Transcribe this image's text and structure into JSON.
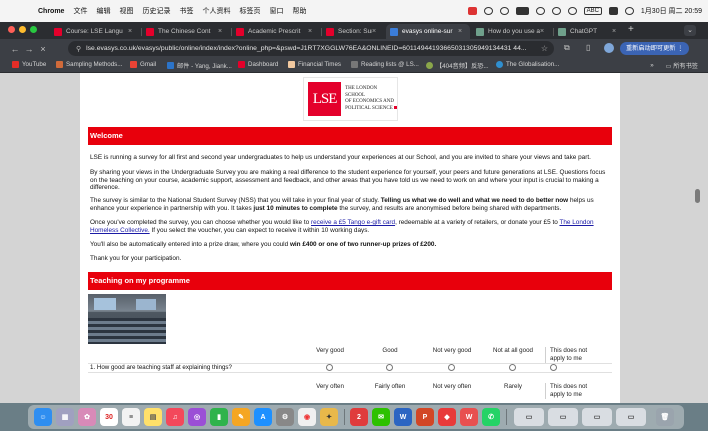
{
  "menubar": {
    "app": "Chrome",
    "items": [
      "文件",
      "编辑",
      "视图",
      "历史记录",
      "书签",
      "个人资料",
      "标签页",
      "窗口",
      "帮助"
    ],
    "input_method": "ABC",
    "datetime": "1月30日 周二  20:59"
  },
  "tabs": [
    {
      "label": "Course: LSE Langu",
      "color": "#e4002b"
    },
    {
      "label": "The Chinese Cont",
      "color": "#e4002b"
    },
    {
      "label": "Academic Prescrit",
      "color": "#e4002b"
    },
    {
      "label": "Section: Summatil",
      "color": "#e4002b"
    },
    {
      "label": "evasys online-sur",
      "color": "#3b7dd8",
      "active": true
    },
    {
      "label": "How do you use a",
      "color": "#6fa08b"
    },
    {
      "label": "ChatGPT",
      "color": "#6fa08b"
    }
  ],
  "toolbar": {
    "url": "lse.evasys.co.uk/evasys/public/online/index/index?online_php=&pswd=J1RT7XGGLW76EA&ONLINEID=60114944193665031305949134431 44...",
    "update_label": "重新启动即可更新"
  },
  "bookmarks": {
    "items": [
      {
        "label": "YouTube",
        "color": "#e52d27"
      },
      {
        "label": "Sampling Methods...",
        "color": "#d06a3a"
      },
      {
        "label": "Gmail",
        "color": "#ea4335"
      },
      {
        "label": "邮件 - Yang, Jiank...",
        "color": "#2b73c8"
      },
      {
        "label": "Dashboard",
        "color": "#e4002b"
      },
      {
        "label": "Financial Times",
        "color": "#f2c9a0"
      },
      {
        "label": "Reading lists @ LS...",
        "color": "#555555"
      },
      {
        "label": "【404音频】反恐...",
        "color": "#8aa64a"
      },
      {
        "label": "The Globalisation...",
        "color": "#2f8fd0"
      }
    ],
    "all_bookmarks": "所有书签"
  },
  "page": {
    "logo": {
      "mark": "LSE",
      "line1": "THE LONDON SCHOOL",
      "line2": "OF ECONOMICS AND",
      "line3": "POLITICAL SCIENCE"
    },
    "welcome": {
      "heading": "Welcome",
      "p1": "LSE is running a survey for all first and second year undergraduates to help us understand your experiences at our School, and you are invited to share your views and take part.",
      "p2a": "By sharing your views in the Undergraduate Survey you are making a real difference to the student experience for yourself, your peers and future generations at LSE. Questions focus on the teaching on your course, academic support, assessment and feedback, and other areas that you have told us we need to work on and where your input is crucial to making a difference.",
      "p3a": "The survey is similar to the National Student Survey (NSS) that you will take in your final year of study.",
      "p3b": "Telling us what we do well and what we need to do better now",
      "p3c": "helps us enhance your experience in partnership with you. It takes",
      "p3d": "just 10 minutes to complete",
      "p3e": "the survey, and results are anonymised before being shared with departments.",
      "p4a": "Once you've completed the survey, you can choose whether you would like to",
      "p4link1": "receive a £5 Tango e-gift card",
      "p4b": ", redeemable at a variety of retailers, or donate your £5 to",
      "p4link2": "The London Homeless Collective.",
      "p4c": "If you select the voucher, you can expect to receive it within 10 working days.",
      "p5a": "You'll also be automatically entered into a prize draw, where you could",
      "p5b": "win £400 or one of two runner-up prizes of £200.",
      "p6": "Thank you for your participation."
    },
    "teaching": {
      "heading": "Teaching on my programme",
      "scale1": [
        "Very good",
        "Good",
        "Not very good",
        "Not at all good",
        "This does not apply to me"
      ],
      "q1": "1. How good are teaching staff at explaining things?",
      "scale2": [
        "Very often",
        "Fairly often",
        "Not very often",
        "Rarely",
        "This does not apply to me"
      ]
    }
  }
}
